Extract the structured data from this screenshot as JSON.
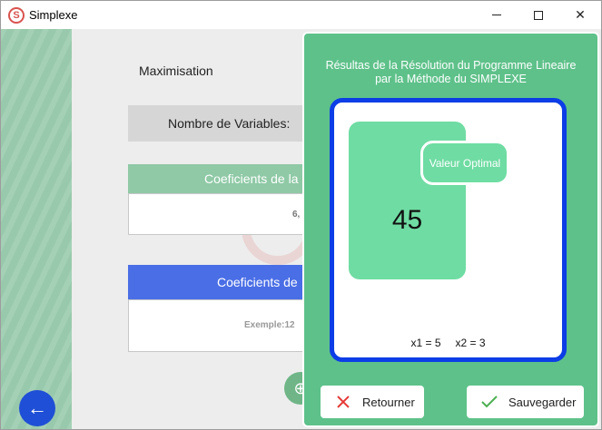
{
  "window": {
    "title": "Simplexe",
    "app_icon_letter": "S",
    "minimize_label": "",
    "maximize_label": "",
    "close_label": "✕"
  },
  "background_form": {
    "objective": "Maximisation",
    "variables_label": "Nombre de Variables:",
    "coef_objective_header": "Coeficients de la",
    "coef_objective_value": "6,",
    "coef_constraints_header": "Coeficients de",
    "coef_constraints_example": "Exemple:12",
    "back_icon_glyph": "←",
    "add_icon_glyph": "⊕"
  },
  "result_dialog": {
    "title_line1": "Résultas de la Résolution du Programme Lineaire",
    "title_line2": "par la Méthode du SIMPLEXE",
    "optimal_label": "Valeur Optimal",
    "optimal_value": "45",
    "variables": [
      "x1 = 5",
      "x2 = 3"
    ],
    "return_label": "Retourner",
    "save_label": "Sauvegarder"
  },
  "colors": {
    "dialog_bg": "#5ec18a",
    "panel_border": "#0c3de6",
    "card": "#6fdca3",
    "return_icon": "#e53935",
    "save_icon": "#4caf50"
  }
}
